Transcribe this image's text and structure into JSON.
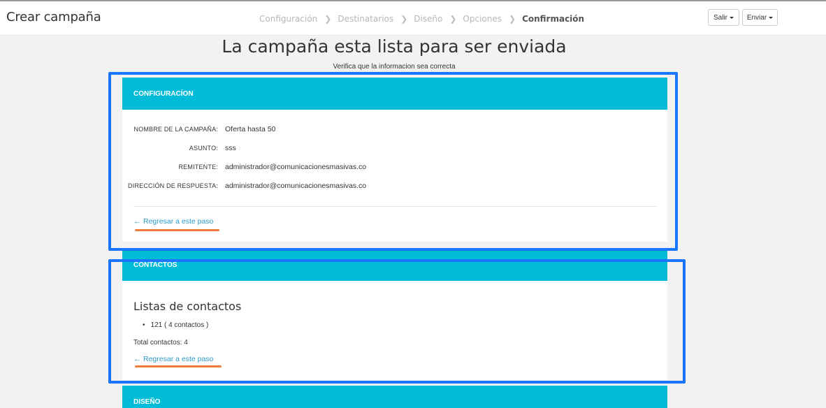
{
  "app": {
    "title": "Crear campaña"
  },
  "steps": [
    "Configuración",
    "Destinatarios",
    "Diseño",
    "Opciones",
    "Confirmación"
  ],
  "header_buttons": {
    "salir": "Salir",
    "enviar": "Enviar"
  },
  "page": {
    "heading": "La campaña esta lista para ser enviada",
    "subheading": "Verifica que la informacion sea correcta"
  },
  "config": {
    "title": "CONFIGURACÍON",
    "fields": [
      {
        "label": "NOMBRE DE LA CAMPAÑA:",
        "value": "Oferta hasta 50"
      },
      {
        "label": "ASUNTO:",
        "value": "sss"
      },
      {
        "label": "REMITENTE:",
        "value": "administrador@comunicacionesmasivas.co"
      },
      {
        "label": "DIRECCIÓN DE RESPUESTA:",
        "value": "administrador@comunicacionesmasivas.co"
      }
    ],
    "back_link": "Regresar a este paso"
  },
  "contacts": {
    "title": "CONTACTOS",
    "list_title": "Listas de contactos",
    "items": [
      "121 ( 4 contactos )"
    ],
    "total": "Total contactos: 4",
    "back_link": "Regresar a este paso"
  },
  "design": {
    "title": "DISEÑO"
  },
  "colors": {
    "panel_header": "#00bcd9",
    "link": "#2d9ac7",
    "highlight_box": "#1a75ff",
    "underline": "#f07a3a"
  },
  "icons": {
    "step_separator": "chevron-right-icon",
    "back_arrow": "arrow-left-icon",
    "dropdown": "caret-down-icon"
  }
}
